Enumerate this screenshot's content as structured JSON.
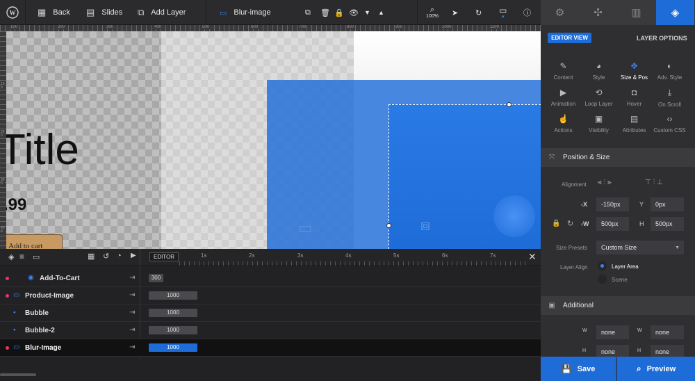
{
  "toolbar": {
    "back_label": "Back",
    "slides_label": "Slides",
    "add_layer_label": "Add Layer",
    "layer_name": "Blur-image",
    "zoom_label": "100%"
  },
  "ruler": {
    "top_marks": [
      "100",
      "200",
      "300",
      "400",
      "500",
      "600",
      "700",
      "800",
      "900",
      "1000",
      "1100"
    ],
    "left_marks": [
      "100",
      "200",
      "300",
      "400"
    ]
  },
  "canvas": {
    "title_text": "Title",
    "price_text": ".99",
    "cart_text": "Add to cart"
  },
  "timeline": {
    "editor_label": "EDITOR",
    "ticks": [
      "1s",
      "2s",
      "3s",
      "4s",
      "5s",
      "6s",
      "7s"
    ],
    "layers": [
      {
        "name": "Add-To-Cart",
        "duration": "300",
        "has_dot": true,
        "icon": "circle-icon"
      },
      {
        "name": "Product-Image",
        "duration": "1000",
        "has_dot": true,
        "icon": "image-icon"
      },
      {
        "name": "Bubble",
        "duration": "1000",
        "has_dot": false,
        "icon": "shape-icon"
      },
      {
        "name": "Bubble-2",
        "duration": "1000",
        "has_dot": false,
        "icon": "shape-icon"
      },
      {
        "name": "Blur-Image",
        "duration": "1000",
        "has_dot": true,
        "icon": "image-icon",
        "selected": true
      }
    ]
  },
  "panel": {
    "editor_view_label": "EDITOR VIEW",
    "layer_options_label": "LAYER OPTIONS",
    "options": [
      {
        "label": "Content",
        "icon": "pencil-icon"
      },
      {
        "label": "Style",
        "icon": "palette-icon"
      },
      {
        "label": "Size & Pos",
        "icon": "move-icon"
      },
      {
        "label": "Adv. Style",
        "icon": "contrast-icon"
      },
      {
        "label": "Animation",
        "icon": "play-icon"
      },
      {
        "label": "Loop Layer",
        "icon": "loop-icon"
      },
      {
        "label": "Hover",
        "icon": "mouse-icon"
      },
      {
        "label": "On Scroll",
        "icon": "scroll-icon"
      },
      {
        "label": "Actions",
        "icon": "hand-icon"
      },
      {
        "label": "Visibility",
        "icon": "visibility-icon"
      },
      {
        "label": "Attributes",
        "icon": "attributes-icon"
      },
      {
        "label": "Custom CSS",
        "icon": "code-icon"
      }
    ],
    "position_size_label": "Position & Size",
    "alignment_label": "Alignment",
    "x_label": "X",
    "x_value": "-150px",
    "y_label": "Y",
    "y_value": "0px",
    "w_label": "W",
    "w_value": "500px",
    "h_label": "H",
    "h_value": "500px",
    "size_presets_label": "Size Presets",
    "size_presets_value": "Custom Size",
    "layer_align_label": "Layer Align",
    "layer_area_label": "Layer Area",
    "scene_label": "Scene",
    "additional_label": "Additional",
    "min_w_value": "none",
    "max_w_value": "none",
    "min_h_value": "none",
    "max_h_value": "none",
    "save_label": "Save",
    "preview_label": "Preview"
  },
  "colors": {
    "accent": "#1e6cd8",
    "layer_dot": "#e8336d"
  }
}
